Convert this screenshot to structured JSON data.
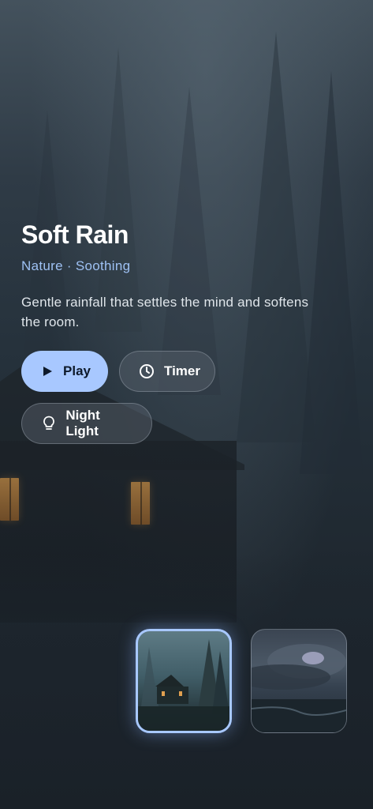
{
  "sound": {
    "title": "Soft Rain",
    "category_line": "Nature · Soothing",
    "description": "Gentle rainfall that settles the mind and softens the room."
  },
  "actions": {
    "play_label": "Play",
    "timer_label": "Timer",
    "night_light_label": "Night Light"
  },
  "icons": {
    "play": "play-icon",
    "timer": "clock-icon",
    "night_light": "lightbulb-icon"
  },
  "colors": {
    "accent": "#a8c8ff",
    "subtitle": "#9ec1f3",
    "background": "#1c2630"
  },
  "thumbnails": [
    {
      "scene": "forest-cabin",
      "selected": true
    },
    {
      "scene": "storm-clouds",
      "selected": false
    }
  ]
}
